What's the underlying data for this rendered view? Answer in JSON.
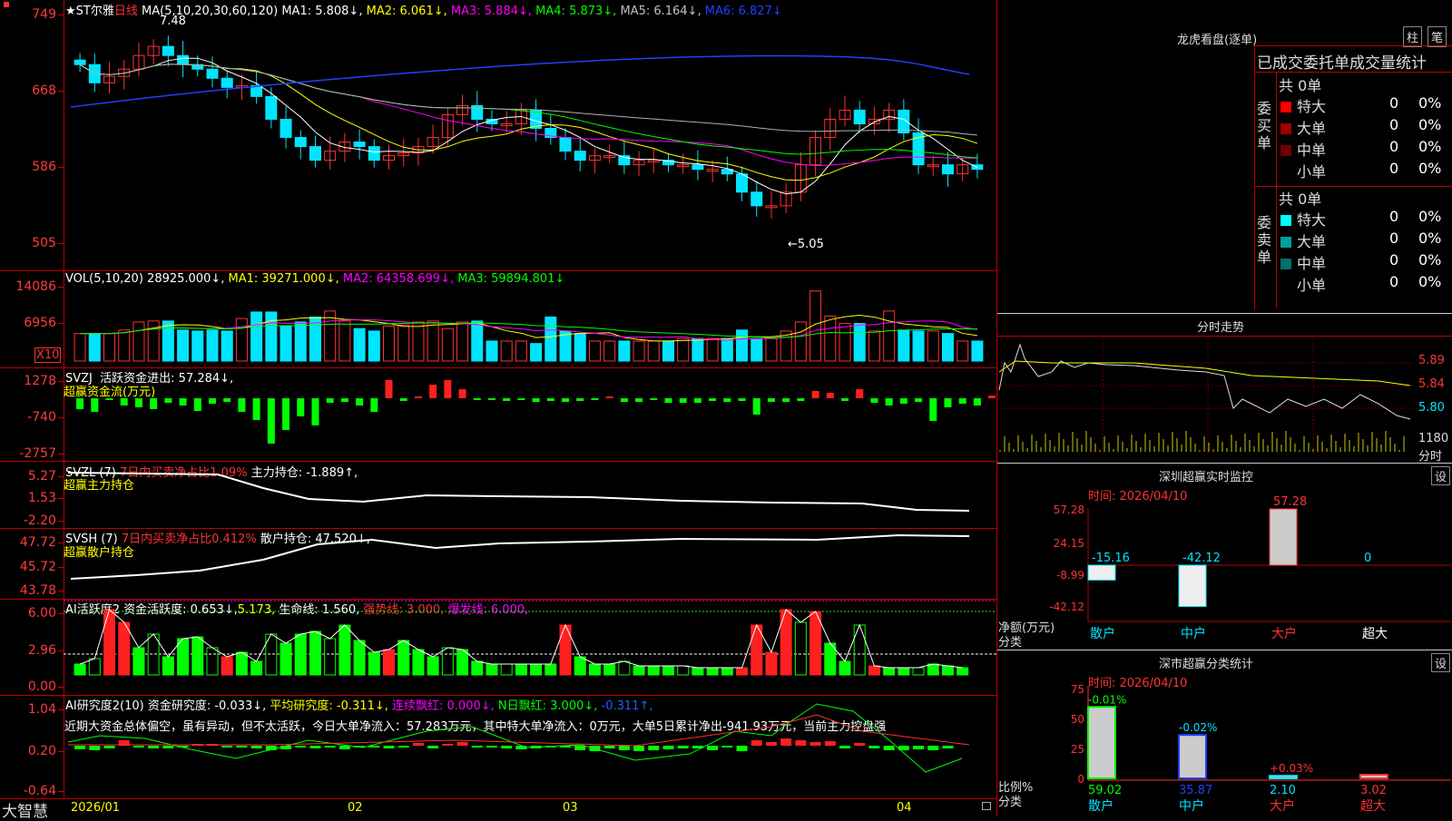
{
  "main": {
    "header": {
      "star": "★ST尔雅",
      "period": "日线",
      "ma_params": "MA(5,10,20,30,60,120)",
      "ma1": "MA1: 5.808↓,",
      "ma2": "MA2: 6.061↓,",
      "ma3": "MA3: 5.884↓,",
      "ma4": "MA4: 5.873↓,",
      "ma5": "MA5: 6.164↓,",
      "ma6": "MA6: 6.827↓"
    },
    "yticks": [
      "749",
      "668",
      "586",
      "505"
    ],
    "high_marker": "7.48",
    "low_marker": "←5.05",
    "colors": {
      "up": "#ff3232",
      "down": "#00e5ff",
      "ma1": "#ffffff",
      "ma2": "#ffff00",
      "ma3": "#ff00ff",
      "ma4": "#00ff00",
      "ma5": "#b0b0b0",
      "ma6": "#2040ff"
    }
  },
  "vol": {
    "header": "VOL(5,10,20)",
    "val": "28925.000↓,",
    "ma1": "MA1: 39271.000↓,",
    "ma2": "MA2: 64358.699↓,",
    "ma3": "MA3: 59894.801↓",
    "yticks": [
      "14086",
      "6956"
    ],
    "unit": "X10"
  },
  "svzj": {
    "header": "SVZJ",
    "label": "活跃资金进出: 57.284↓,",
    "sub": "超赢资金流(万元)",
    "yticks": [
      "1278",
      "-740",
      "-2757"
    ]
  },
  "svzl": {
    "header": "SVZL (7)",
    "pct": "7日内买卖净占比1.09%",
    "label": "主力持仓: -1.889↑,",
    "sub": "超赢主力持仓",
    "yticks": [
      "5.27",
      "1.53",
      "-2.20"
    ]
  },
  "svsh": {
    "header": "SVSH (7)",
    "pct": "7日内买卖净占比0.412%",
    "label": "散户持仓: 47.520↓,",
    "sub": "超赢散户持仓",
    "yticks": [
      "47.72",
      "45.72",
      "43.78"
    ]
  },
  "ai1": {
    "header": "AI活跃度2",
    "act": "资金活跃度: 0.653↓,",
    "act2": "5.173,",
    "life": "生命线: 1.560,",
    "strong": "强势线: 3.000,",
    "burst": "爆发线: 6.000,",
    "yticks": [
      "6.00",
      "2.96",
      "0.00"
    ]
  },
  "ai2": {
    "header": "AI研究度2(10)",
    "res": "资金研究度: -0.033↓,",
    "avg": "平均研究度: -0.311↓,",
    "lianxu": "连续飘红: 0.000↓,",
    "nday": "N日飘红: 3.000↓,",
    "last": "-0.311↑,",
    "comment": "近期大资金总体偏空，虽有异动，但不太活跃，今日大单净流入：57.283万元，其中特大单净流入：0万元，大单5日累计净出-941.93万元，当前主力控盘强",
    "yticks": [
      "1.04",
      "0.20",
      "-0.64"
    ]
  },
  "xaxis": {
    "labels": [
      "2026/01",
      "02",
      "03",
      "04"
    ]
  },
  "brand": "大智慧",
  "right": {
    "dragon": {
      "title": "龙虎看盘(逐单)",
      "btn1": "柱",
      "btn2": "笔",
      "subtitle": "已成交委托单成交量统计",
      "buy_side": "委买单",
      "sell_side": "委卖单",
      "buy_total": "共 0单",
      "sell_total": "共 0单",
      "buy_rows": [
        {
          "name": "特大",
          "val": "0",
          "pct": "0%",
          "color": "#ff0000"
        },
        {
          "name": "大单",
          "val": "0",
          "pct": "0%",
          "color": "#a00000"
        },
        {
          "name": "中单",
          "val": "0",
          "pct": "0%",
          "color": "#700000"
        },
        {
          "name": "小单",
          "val": "0",
          "pct": "0%",
          "color": "#000000"
        }
      ],
      "sell_rows": [
        {
          "name": "特大",
          "val": "0",
          "pct": "0%",
          "color": "#00ffff"
        },
        {
          "name": "大单",
          "val": "0",
          "pct": "0%",
          "color": "#00a0a0"
        },
        {
          "name": "中单",
          "val": "0",
          "pct": "0%",
          "color": "#007070"
        },
        {
          "name": "小单",
          "val": "0",
          "pct": "0%",
          "color": "#000000"
        }
      ]
    },
    "intraday": {
      "title": "分时走势",
      "yticks": [
        "5.89",
        "5.84",
        "5.80"
      ],
      "vol": "1180",
      "unit": "分时"
    },
    "monitor": {
      "title": "深圳超赢实时监控",
      "btn": "设",
      "time": "时间: 2026/04/10",
      "ylabel": "净额(万元)",
      "xlabel": "分类",
      "yticks": [
        "57.28",
        "24.15",
        "-8.99",
        "-42.12"
      ],
      "bars": [
        {
          "cat": "散户",
          "value": -15.16,
          "label": "-15.16"
        },
        {
          "cat": "中户",
          "value": -42.12,
          "label": "-42.12"
        },
        {
          "cat": "大户",
          "value": 57.28,
          "label": "57.28"
        },
        {
          "cat": "超大",
          "value": 0,
          "label": "0"
        }
      ]
    },
    "classify": {
      "title": "深市超赢分类统计",
      "btn": "设",
      "time": "时间: 2026/04/10",
      "ylabel": "比例%",
      "xlabel": "分类",
      "yticks": [
        "75",
        "50",
        "25",
        "0"
      ],
      "bars": [
        {
          "cat": "散户",
          "value": 59.02,
          "label": "59.02",
          "delta": "-0.01%"
        },
        {
          "cat": "中户",
          "value": 35.87,
          "label": "35.87",
          "delta": "-0.02%"
        },
        {
          "cat": "大户",
          "value": 2.1,
          "label": "2.10",
          "delta": "+0.03%"
        },
        {
          "cat": "超大",
          "value": 3.02,
          "label": "3.02",
          "delta": ""
        }
      ]
    }
  },
  "chart_data": [
    {
      "type": "candlestick",
      "title": "★ST尔雅 日线",
      "ylim": [
        5.05,
        7.48
      ],
      "close": [
        6.95,
        6.75,
        6.82,
        6.9,
        7.05,
        7.15,
        7.05,
        6.95,
        6.9,
        6.8,
        6.7,
        6.72,
        6.6,
        6.35,
        6.15,
        6.05,
        5.9,
        6.0,
        6.1,
        6.05,
        5.9,
        5.95,
        5.98,
        6.05,
        6.15,
        6.4,
        6.5,
        6.35,
        6.3,
        6.3,
        6.45,
        6.25,
        6.15,
        6.0,
        5.9,
        5.95,
        5.95,
        5.85,
        5.9,
        5.9,
        5.85,
        5.85,
        5.8,
        5.8,
        5.75,
        5.55,
        5.4,
        5.4,
        5.55,
        5.85,
        6.15,
        6.35,
        6.45,
        6.3,
        6.35,
        6.45,
        6.2,
        5.85,
        5.85,
        5.75,
        5.85,
        5.8
      ]
    },
    {
      "type": "bar",
      "title": "VOL",
      "values": [
        55,
        55,
        55,
        62,
        78,
        80,
        80,
        62,
        60,
        62,
        60,
        85,
        98,
        98,
        70,
        78,
        88,
        100,
        80,
        65,
        60,
        70,
        72,
        78,
        80,
        65,
        78,
        80,
        40,
        40,
        40,
        35,
        88,
        60,
        55,
        40,
        40,
        40,
        40,
        40,
        40,
        45,
        45,
        45,
        45,
        62,
        45,
        45,
        60,
        78,
        140,
        90,
        75,
        75,
        60,
        100,
        62,
        60,
        60,
        55,
        40,
        40
      ]
    }
  ]
}
